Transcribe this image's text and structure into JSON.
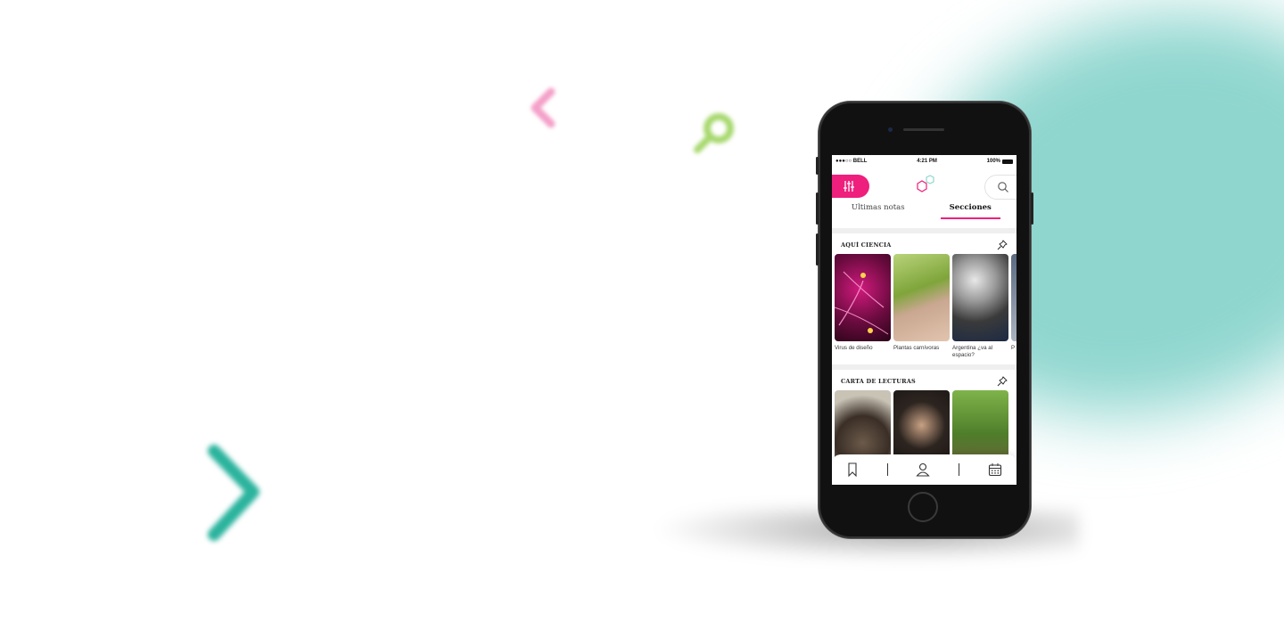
{
  "colors": {
    "accent_pink": "#ee1f7d",
    "accent_teal": "#8fd6cf",
    "deco_teal": "#2bb39d",
    "deco_green": "#a7d86e",
    "deco_pink": "#f4a0c8"
  },
  "decorations": {
    "pink_chevron": "chevron-left-icon",
    "green_magnifier": "search-icon",
    "teal_chevron": "chevron-right-icon"
  },
  "status_bar": {
    "carrier": "●●●○○ BELL",
    "time": "4:21 PM",
    "battery": "100%"
  },
  "header": {
    "filter_icon": "sliders-icon",
    "logo_icon": "hexagons-logo-icon",
    "search_icon": "search-icon"
  },
  "tabs": [
    {
      "label": "Ultimas notas",
      "active": false
    },
    {
      "label": "Secciones",
      "active": true
    }
  ],
  "sections": [
    {
      "title": "AQUÍ CIENCIA",
      "pin_icon": "pin-icon",
      "cards": [
        {
          "label": "Virus de diseño"
        },
        {
          "label": "Plantas carnívoras"
        },
        {
          "label": "Argentina ¿va al espacio?"
        },
        {
          "label": "P a"
        }
      ]
    },
    {
      "title": "CARTA DE LECTURAS",
      "pin_icon": "pin-icon",
      "cards": [
        {
          "label": ""
        },
        {
          "label": ""
        },
        {
          "label": ""
        }
      ]
    }
  ],
  "bottom_nav": {
    "items": [
      "bookmark-icon",
      "user-icon",
      "calendar-icon"
    ]
  }
}
